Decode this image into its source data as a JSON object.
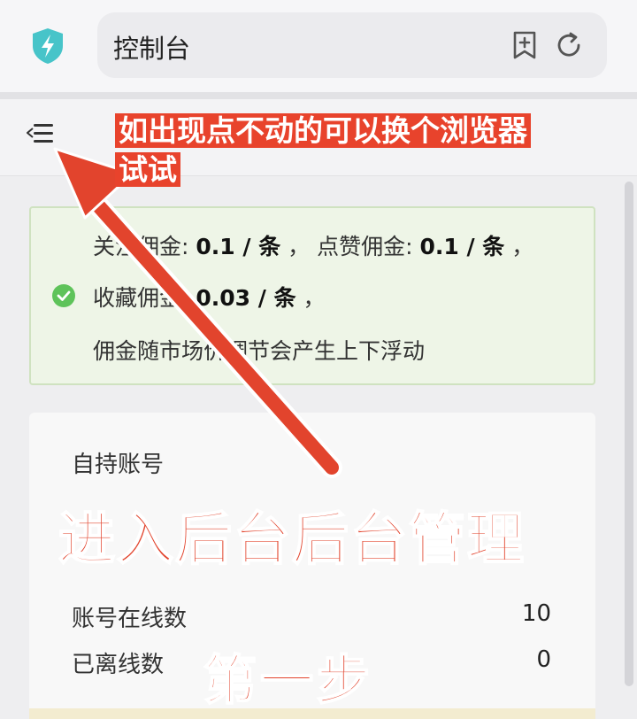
{
  "browser": {
    "address_text": "控制台",
    "icons": [
      "shield-lightning-icon",
      "bookmark-add-icon",
      "reload-icon"
    ]
  },
  "page": {
    "menu_icon": "menu-collapse-icon"
  },
  "commission_info": {
    "line1_prefix": "关注佣金: ",
    "follow_value": "0.1 / 条",
    "line1_mid": " ， 点赞佣金: ",
    "like_value": "0.1 / 条",
    "line1_suffix": " ，",
    "line2_prefix": "收藏佣金: ",
    "favorite_value": "0.03 / 条",
    "line2_suffix": " ，",
    "line3": "佣金随市场价调节会产生上下浮动"
  },
  "account_card": {
    "title": "自持账号",
    "online_label": "账号在线数",
    "online_value": "10",
    "offline_label": "已离线数",
    "offline_value": "0"
  },
  "annotations": {
    "callout": "如出现点不动的可以换个浏览器试试",
    "main": "进入后台后台管理",
    "step": "第一步",
    "color": "#e2442d"
  }
}
